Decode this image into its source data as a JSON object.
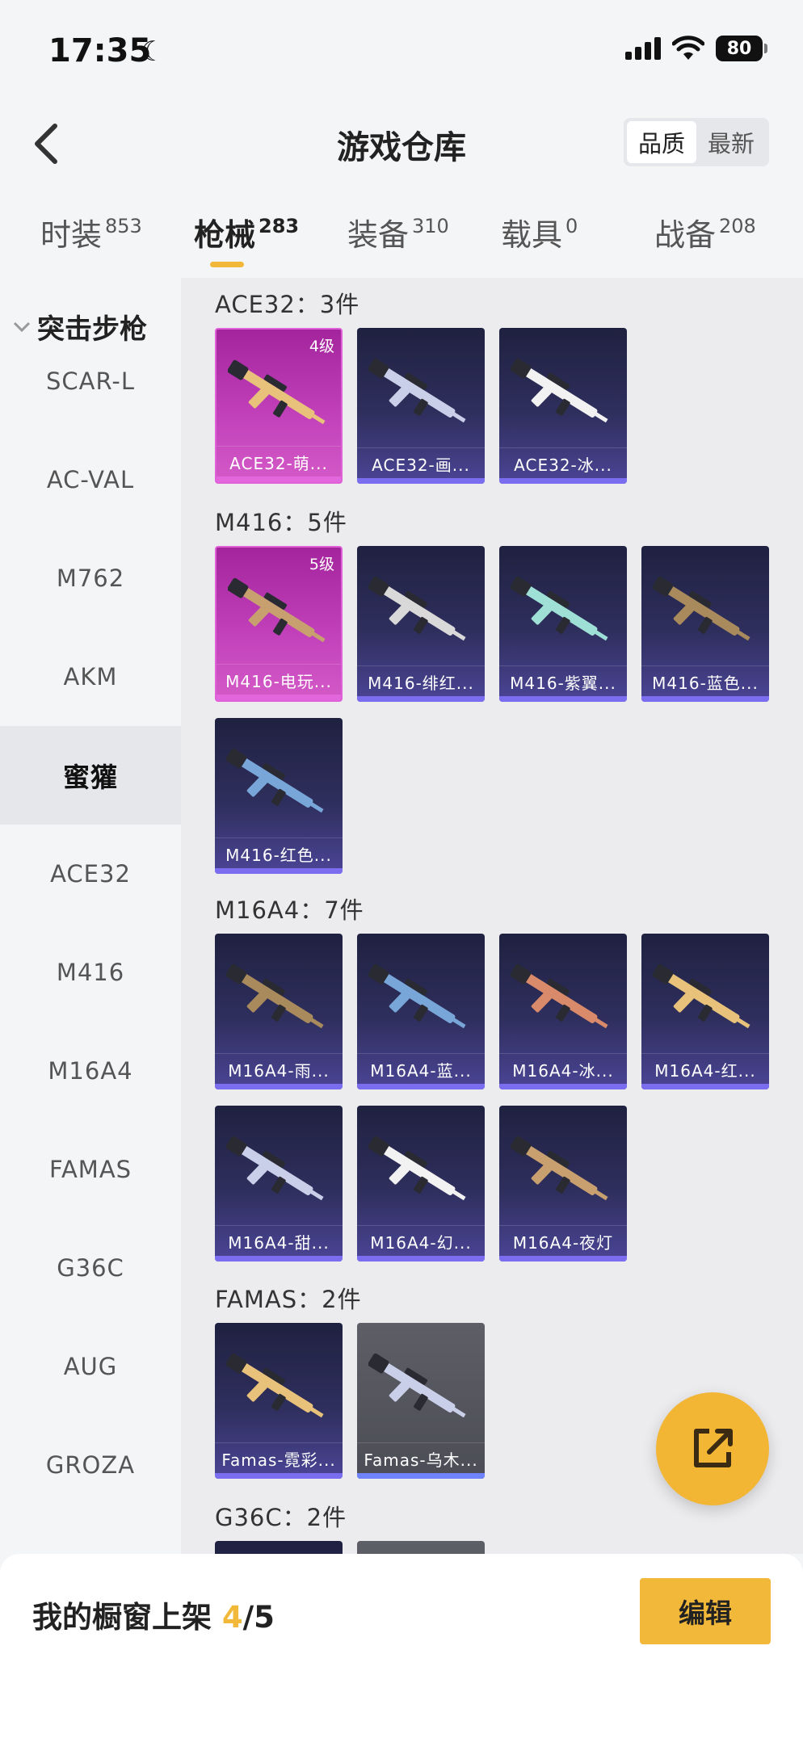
{
  "status_bar": {
    "time": "17:35",
    "battery": "80"
  },
  "header": {
    "title": "游戏仓库",
    "sort_options": [
      "品质",
      "最新"
    ],
    "sort_active": 0
  },
  "tabs": [
    {
      "label": "时装",
      "count": "853"
    },
    {
      "label": "枪械",
      "count": "283",
      "active": true
    },
    {
      "label": "装备",
      "count": "310"
    },
    {
      "label": "载具",
      "count": "0"
    },
    {
      "label": "战备",
      "count": "208"
    }
  ],
  "sidebar": {
    "group": "突击步枪",
    "items": [
      "SCAR-L",
      "AC-VAL",
      "M762",
      "AKM",
      "蜜獾",
      "ACE32",
      "M416",
      "M16A4",
      "FAMAS",
      "G36C",
      "AUG",
      "GROZA"
    ],
    "active_index": 4
  },
  "sections": [
    {
      "title": "ACE32：3件",
      "items": [
        {
          "name": "ACE32-萌...",
          "level": "4级",
          "style": "pink"
        },
        {
          "name": "ACE32-画...",
          "style": "purple"
        },
        {
          "name": "ACE32-冰...",
          "style": "purple"
        }
      ]
    },
    {
      "title": "M416：5件",
      "items": [
        {
          "name": "M416-电玩...",
          "level": "5级",
          "style": "pink"
        },
        {
          "name": "M416-绯红...",
          "style": "purple"
        },
        {
          "name": "M416-紫翼...",
          "style": "purple"
        },
        {
          "name": "M416-蓝色...",
          "style": "purple"
        },
        {
          "name": "M416-红色...",
          "style": "purple"
        }
      ]
    },
    {
      "title": "M16A4：7件",
      "items": [
        {
          "name": "M16A4-雨...",
          "style": "purple"
        },
        {
          "name": "M16A4-蓝...",
          "style": "purple"
        },
        {
          "name": "M16A4-冰...",
          "style": "purple"
        },
        {
          "name": "M16A4-红...",
          "style": "purple"
        },
        {
          "name": "M16A4-甜...",
          "style": "purple"
        },
        {
          "name": "M16A4-幻...",
          "style": "purple"
        },
        {
          "name": "M16A4-夜灯",
          "style": "purple"
        }
      ]
    },
    {
      "title": "FAMAS：2件",
      "items": [
        {
          "name": "Famas-霓彩...",
          "style": "purple"
        },
        {
          "name": "Famas-乌木...",
          "style": "gray"
        }
      ]
    },
    {
      "title": "G36C：2件",
      "items": []
    }
  ],
  "bottom": {
    "showcase_prefix": "我的橱窗上架 ",
    "showcase_used": "4",
    "showcase_total": "/5",
    "edit_label": "编辑"
  },
  "colors": {
    "accent": "#f2b83a",
    "card_purple": "#2f2f5e",
    "card_pink": "#c140ba",
    "card_gray": "#5d5e66"
  }
}
